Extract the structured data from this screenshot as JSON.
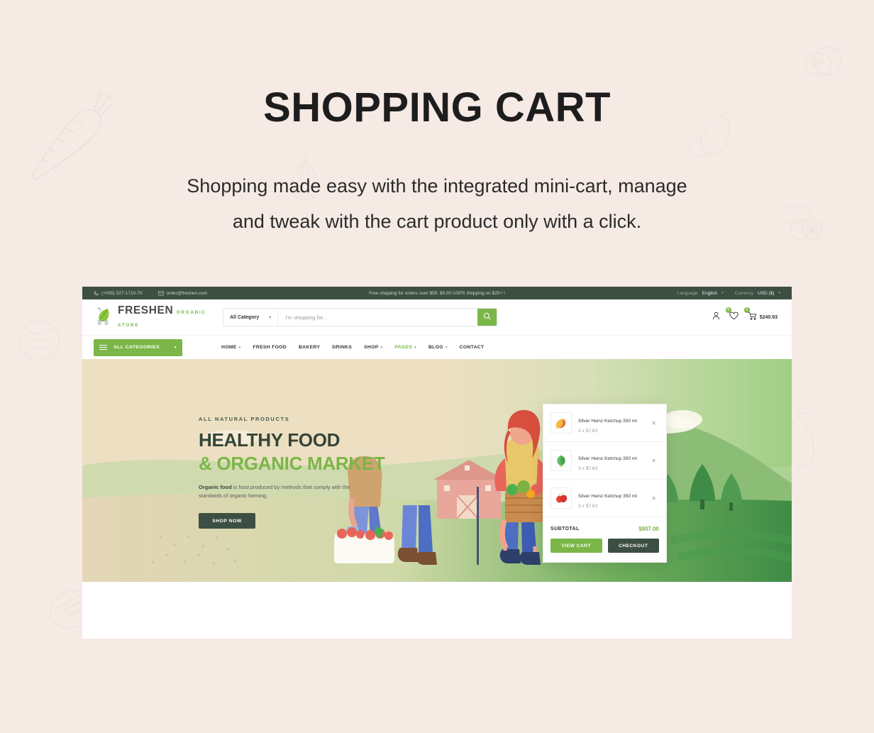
{
  "page": {
    "title": "SHOPPING CART",
    "subtitle_line1": "Shopping made easy with the integrated mini-cart, manage",
    "subtitle_line2": "and tweak with the cart product only with a click.",
    "background_color": "#f6eae5"
  },
  "topbar": {
    "phone_icon": "phone-icon",
    "phone": "(+035) 527-1710-70",
    "email_icon": "envelope-icon",
    "email": "order@freshen.com",
    "promo": "Free shipping for orders over $59. $5.00 USPS Shipping on $25+ !",
    "language_label": "Language",
    "language_value": "English",
    "currency_label": "Currency",
    "currency_value": "USD ($)",
    "background_color": "#3d4f42"
  },
  "header": {
    "logo_name": "FRESHEN",
    "logo_tagline": "ORGANIC STORE",
    "category_select": "All Category",
    "search_placeholder": "I'm shopping for...",
    "search_value": "",
    "search_icon": "search-icon",
    "account_icon": "user-icon",
    "wishlist_icon": "heart-icon",
    "wishlist_count": "0",
    "cart_icon": "cart-icon",
    "cart_count": "3",
    "cart_amount": "$240.93"
  },
  "nav": {
    "all_categories": "ALL CATEGORIES",
    "links": [
      {
        "label": "HOME",
        "has_caret": true,
        "active": false
      },
      {
        "label": "FRESH FOOD",
        "has_caret": false,
        "active": false
      },
      {
        "label": "BAKERY",
        "has_caret": false,
        "active": false
      },
      {
        "label": "DRINKS",
        "has_caret": false,
        "active": false
      },
      {
        "label": "SHOP",
        "has_caret": true,
        "active": false
      },
      {
        "label": "PAGES",
        "has_caret": true,
        "active": true
      },
      {
        "label": "BLOG",
        "has_caret": true,
        "active": false
      },
      {
        "label": "CONTACT",
        "has_caret": false,
        "active": false
      }
    ],
    "accent_color": "#7ab648"
  },
  "hero": {
    "eyebrow": "ALL NATURAL PRODUCTS",
    "heading_line1": "HEALTHY FOOD",
    "heading_line2": "& ORGANIC MARKET",
    "description_bold": "Organic food",
    "description_rest": " is food produced by methods that comply with the standards of organic farming.",
    "cta": "SHOP NOW",
    "heading_dark_color": "#36443a",
    "heading_green_color": "#7ab648"
  },
  "minicart": {
    "items": [
      {
        "name": "Silver Heinz Ketchup 350 ml",
        "qty_price": "3 x $7.63",
        "thumb": "mango-image",
        "remove_icon": "close-icon"
      },
      {
        "name": "Silver Heinz Ketchup 350 ml",
        "qty_price": "3 x $7.63",
        "thumb": "leafy-greens-image",
        "remove_icon": "close-icon"
      },
      {
        "name": "Silver Heinz Ketchup 350 ml",
        "qty_price": "3 x $7.63",
        "thumb": "strawberry-image",
        "remove_icon": "close-icon"
      }
    ],
    "subtotal_label": "SUBTOTAL",
    "subtotal_value": "$907.00",
    "view_cart": "VIEW CART",
    "checkout": "CHECKOUT",
    "view_cart_color": "#7ab648",
    "checkout_color": "#3d4f42"
  }
}
